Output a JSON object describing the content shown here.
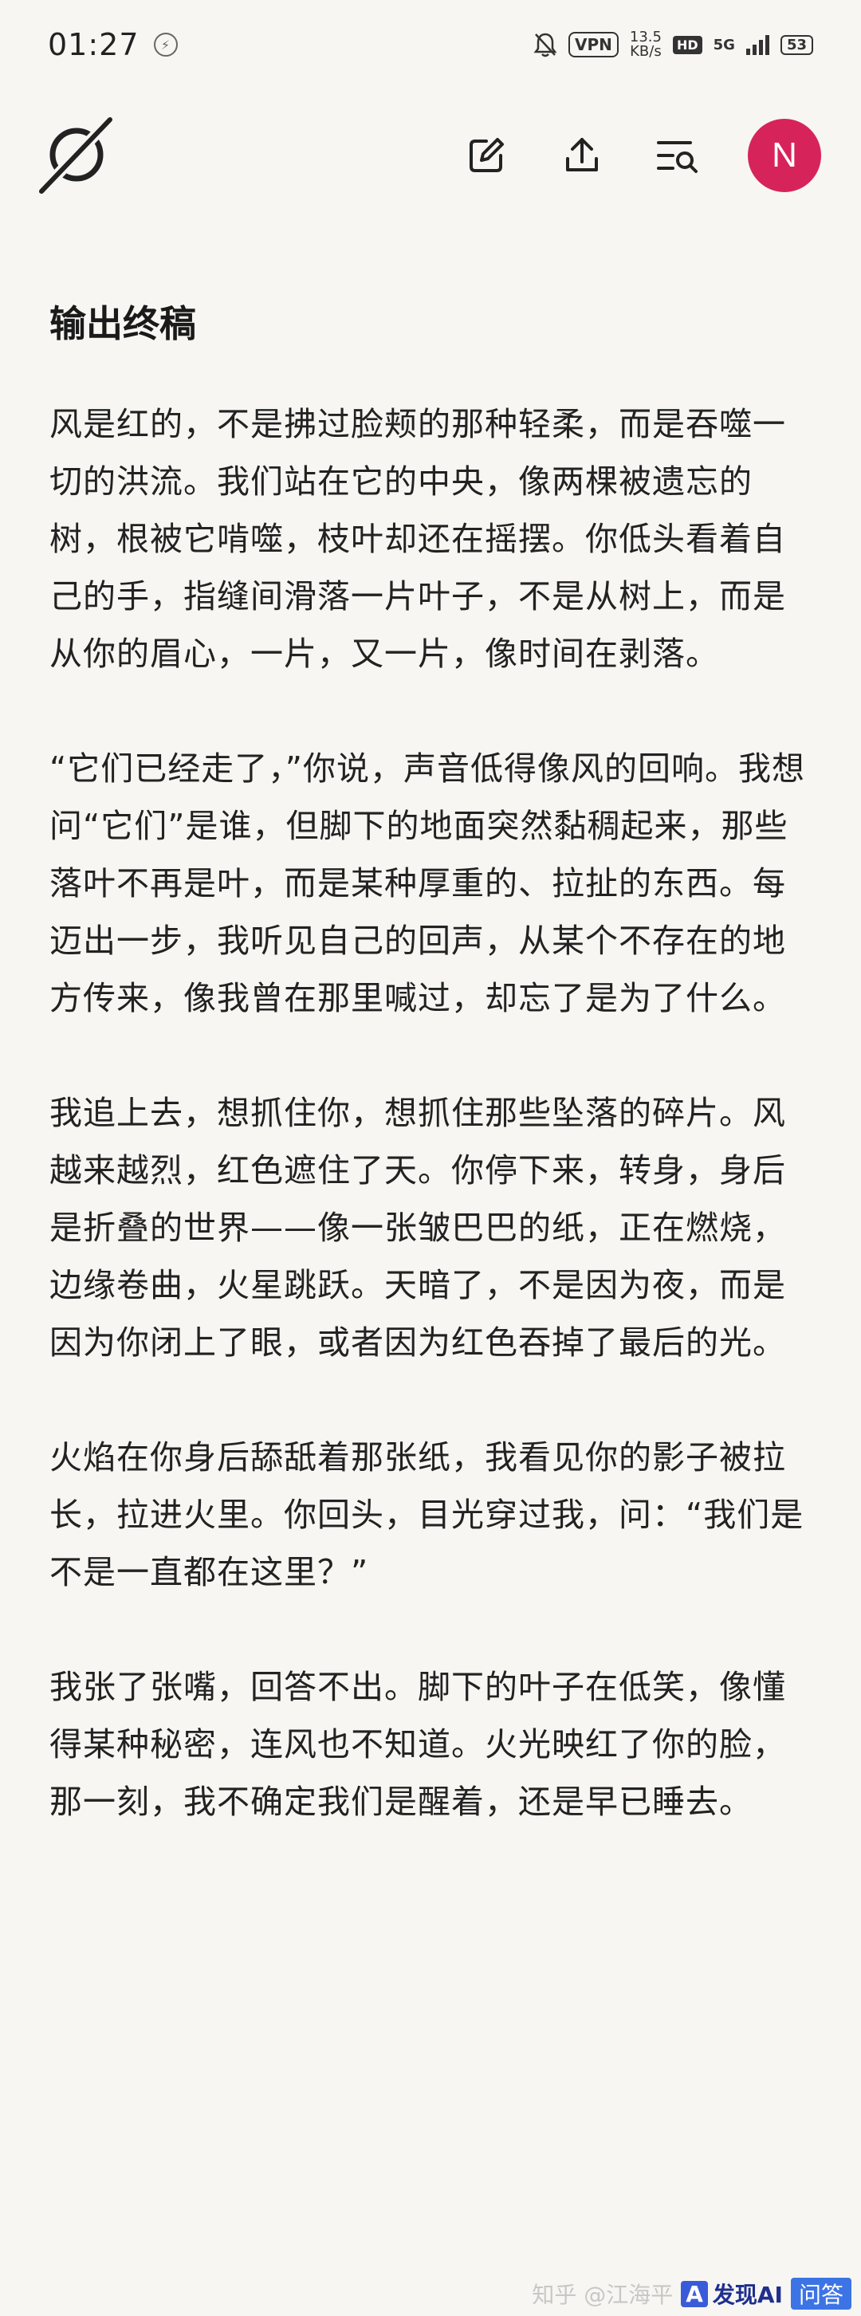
{
  "status": {
    "time": "01:27",
    "vpn": "VPN",
    "speed_value": "13.5",
    "speed_unit": "KB/s",
    "hd": "HD",
    "network": "5G",
    "battery": "53"
  },
  "header": {
    "avatar_letter": "N",
    "icons": [
      "logo-icon",
      "edit-icon",
      "share-icon",
      "search-list-icon"
    ]
  },
  "article": {
    "title": "输出终稿",
    "paragraphs": [
      "风是红的，不是拂过脸颊的那种轻柔，而是吞噬一切的洪流。我们站在它的中央，像两棵被遗忘的树，根被它啃噬，枝叶却还在摇摆。你低头看着自己的手，指缝间滑落一片叶子，不是从树上，而是从你的眉心，一片，又一片，像时间在剥落。",
      "“它们已经走了，”你说，声音低得像风的回响。我想问“它们”是谁，但脚下的地面突然黏稠起来，那些落叶不再是叶，而是某种厚重的、拉扯的东西。每迈出一步，我听见自己的回声，从某个不存在的地方传来，像我曾在那里喊过，却忘了是为了什么。",
      "我追上去，想抓住你，想抓住那些坠落的碎片。风越来越烈，红色遮住了天。你停下来，转身，身后是折叠的世界——像一张皱巴巴的纸，正在燃烧，边缘卷曲，火星跳跃。天暗了，不是因为夜，而是因为你闭上了眼，或者因为红色吞掉了最后的光。",
      "火焰在你身后舔舐着那张纸，我看见你的影子被拉长，拉进火里。你回头，目光穿过我，问：“我们是不是一直都在这里？”",
      "我张了张嘴，回答不出。脚下的叶子在低笑，像懂得某种秘密，连风也不知道。火光映红了你的脸，那一刻，我不确定我们是醒着，还是早已睡去。"
    ]
  },
  "watermark": {
    "zhihu": "知乎 @江海平",
    "ai_label": "发现AI",
    "ask_label": "问答"
  }
}
